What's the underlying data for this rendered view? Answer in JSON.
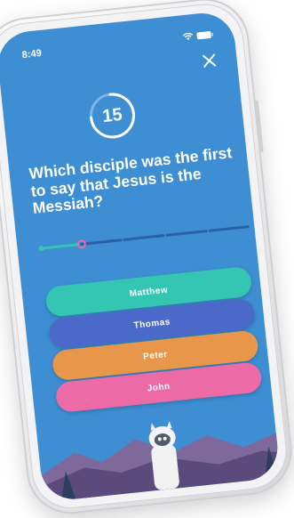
{
  "status": {
    "time": "8:49"
  },
  "timer": {
    "value": "15",
    "remaining_fraction": 0.75
  },
  "question": {
    "text": "Which disciple was the first to say that Jesus is the Messiah?"
  },
  "progress": {
    "total_steps": 5,
    "current_step": 2
  },
  "answers": [
    {
      "label": "Matthew",
      "color": "#35c5b3"
    },
    {
      "label": "Thomas",
      "color": "#4a69c9"
    },
    {
      "label": "Peter",
      "color": "#e8964a"
    },
    {
      "label": "John",
      "color": "#ec6aa6"
    }
  ],
  "colors": {
    "background": "#3d8ed3",
    "accent": "#35c5b3"
  },
  "icons": {
    "close": "close-icon",
    "wifi": "wifi-icon",
    "battery": "battery-icon",
    "mascot": "llama-mascot"
  }
}
